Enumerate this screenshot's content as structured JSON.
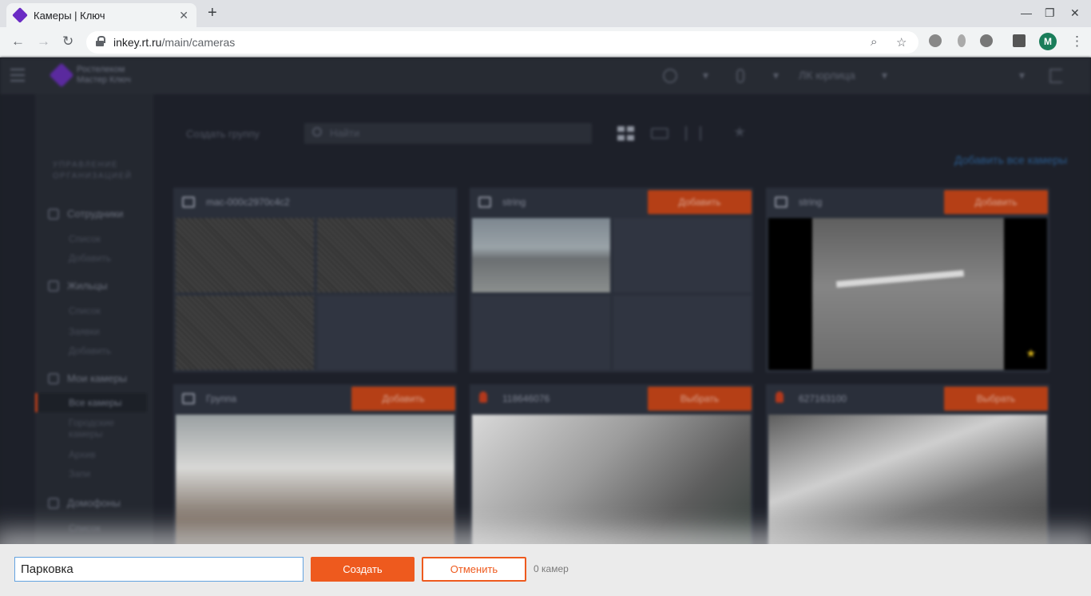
{
  "browser": {
    "tab_title": "Камеры | Ключ",
    "tab_close": "✕",
    "new_tab": "+",
    "url_domain": "inkey.rt.ru",
    "url_path": "/main/cameras",
    "win_minimize": "—",
    "win_restore": "❐",
    "win_close": "✕",
    "nav_back": "←",
    "nav_forward": "→",
    "nav_reload": "↻",
    "zoom_icon": "⌕",
    "bookmark_icon": "☆",
    "menu_icon": "⋮",
    "avatar_letter": "M"
  },
  "app": {
    "logo_line1": "Ростелеком",
    "logo_line2": "Мастер Ключ",
    "header_org": "ЛК юрлица",
    "header_arrow": "▾",
    "sidebar": {
      "section_title": "УПРАВЛЕНИЕ ОРГАНИЗАЦИЕЙ",
      "groups": [
        {
          "label": "Сотрудники",
          "items": [
            "Список",
            "Добавить"
          ]
        },
        {
          "label": "Жильцы",
          "items": [
            "Список",
            "Заявки",
            "Добавить"
          ]
        },
        {
          "label": "Мои камеры",
          "items": [
            "Все камеры",
            "Городские камеры",
            "Архив",
            "Запи"
          ]
        },
        {
          "label": "Домофоны",
          "items": [
            "Список"
          ]
        }
      ]
    },
    "toolbar": {
      "create_group": "Создать группу",
      "search_placeholder": "Найти",
      "add_all": "Добавить все камеры",
      "favorite_icon": "★"
    },
    "cards": [
      {
        "name": "mac-000c2970c4c2",
        "button": ""
      },
      {
        "name": "string",
        "button": "Добавить"
      },
      {
        "name": "string",
        "button": "Добавить"
      },
      {
        "name": "Группа",
        "button": "Добавить"
      },
      {
        "name": "118646076",
        "button": "Выбрать"
      },
      {
        "name": "627163100",
        "button": "Выбрать"
      }
    ],
    "star_icon": "★"
  },
  "dialog": {
    "group_name_value": "Парковка",
    "create_label": "Создать",
    "cancel_label": "Отменить",
    "camera_count": "0 камер"
  }
}
